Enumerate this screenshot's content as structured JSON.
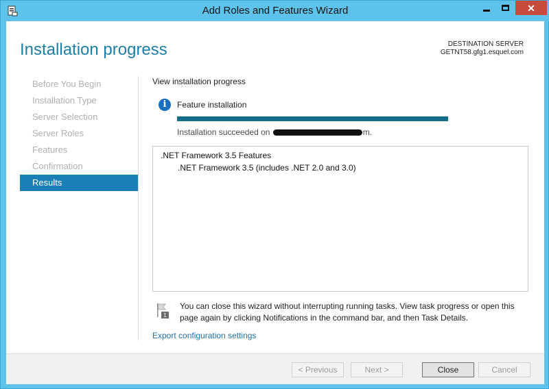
{
  "window": {
    "title": "Add Roles and Features Wizard",
    "close_glyph": "✕"
  },
  "header": {
    "page_title": "Installation progress",
    "destination_label": "DESTINATION SERVER",
    "destination_server": "GETNT58.gfg1.esquel.com"
  },
  "nav": {
    "items": [
      {
        "label": "Before You Begin",
        "active": false
      },
      {
        "label": "Installation Type",
        "active": false
      },
      {
        "label": "Server Selection",
        "active": false
      },
      {
        "label": "Server Roles",
        "active": false
      },
      {
        "label": "Features",
        "active": false
      },
      {
        "label": "Confirmation",
        "active": false
      },
      {
        "label": "Results",
        "active": true
      }
    ]
  },
  "main": {
    "section_title": "View installation progress",
    "info_icon_glyph": "i",
    "feature_label": "Feature installation",
    "progress_fraction": 1.0,
    "status_prefix": "Installation succeeded on",
    "status_suffix": "m.",
    "results": {
      "parent": ".NET Framework 3.5 Features",
      "child": ".NET Framework 3.5 (includes .NET 2.0 and 3.0)"
    },
    "note": "You can close this wizard without interrupting running tasks. View task progress or open this page again by clicking Notifications in the command bar, and then Task Details.",
    "export_link": "Export configuration settings"
  },
  "footer": {
    "previous": "< Previous",
    "next": "Next >",
    "close": "Close",
    "cancel": "Cancel"
  },
  "colors": {
    "title_bar": "#5ec3ea",
    "accent": "#1d7fa7",
    "nav_active": "#1a7fb8",
    "progress": "#146c86",
    "close_button": "#c74b3a"
  },
  "icons": [
    "server-manager-icon",
    "info-icon",
    "notification-flag-icon",
    "minimize-icon",
    "maximize-icon",
    "close-icon"
  ]
}
